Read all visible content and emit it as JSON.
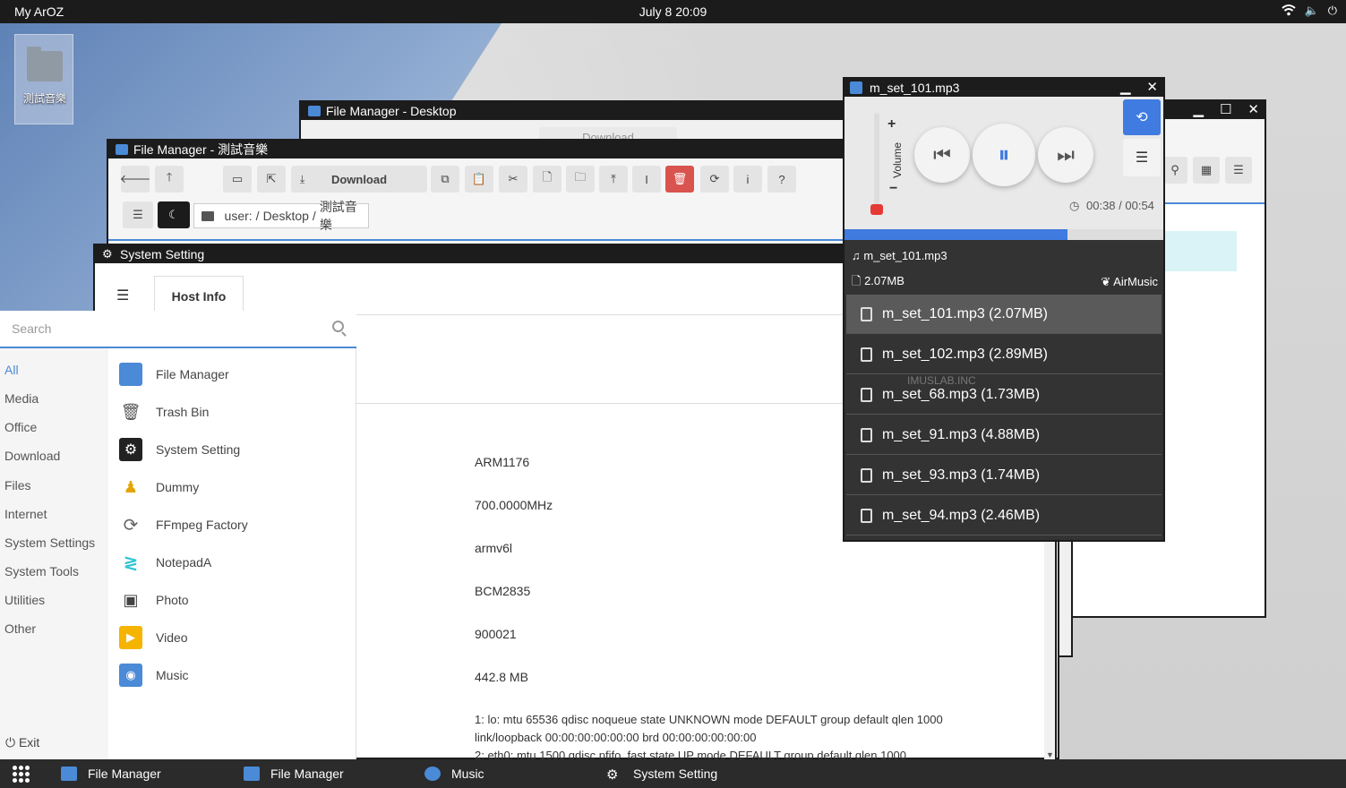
{
  "topbar": {
    "brand": "My ArOZ",
    "clock": "July 8 20:09",
    "wifi": "wifi",
    "volume": "🔈",
    "power": "⏻"
  },
  "desktop": {
    "icon_label": "測試音樂"
  },
  "fm_back": {
    "title": "File Manager - Desktop",
    "download_label": "Download"
  },
  "fm_front": {
    "title": "File Manager - 測試音樂",
    "download_label": "Download",
    "path_root": "user:",
    "path_1": "Desktop",
    "path_2": "測試音樂",
    "sep": "/"
  },
  "system_setting": {
    "title": "System Setting",
    "tab": "Host Info",
    "values": [
      "ARM1176",
      "700.0000MHz",
      "armv6l",
      "BCM2835",
      "900021",
      "442.8 MB"
    ],
    "net_1": "1: lo: mtu 65536 qdisc noqueue state UNKNOWN mode DEFAULT group default qlen 1000",
    "net_2": "link/loopback 00:00:00:00:00:00 brd 00:00:00:00:00:00",
    "net_3": "2: eth0: mtu 1500 qdisc pfifo_fast state UP mode DEFAULT group default qlen 1000"
  },
  "startmenu": {
    "search_placeholder": "Search",
    "categories": [
      "All",
      "Media",
      "Office",
      "Download",
      "Files",
      "Internet",
      "System Settings",
      "System Tools",
      "Utilities",
      "Other"
    ],
    "apps": [
      "File Manager",
      "Trash Bin",
      "System Setting",
      "Dummy",
      "FFmpeg Factory",
      "NotepadA",
      "Photo",
      "Video",
      "Music"
    ],
    "exit": "Exit"
  },
  "player": {
    "title": "m_set_101.mp3",
    "volume_label": "Volume",
    "time": "00:38 / 00:54",
    "progress_fraction": 0.7,
    "now_playing": "m_set_101.mp3",
    "size": "2.07MB",
    "brand": "AirMusic",
    "tracks": [
      "m_set_101.mp3 (2.07MB)",
      "m_set_102.mp3 (2.89MB)",
      "m_set_68.mp3 (1.73MB)",
      "m_set_91.mp3 (4.88MB)",
      "m_set_93.mp3 (1.74MB)",
      "m_set_94.mp3 (2.46MB)"
    ],
    "watermark": "IMUSLAB.INC"
  },
  "taskbar": {
    "items": [
      "File Manager",
      "File Manager",
      "Music",
      "System Setting"
    ]
  },
  "colors": {
    "accent": "#4a8ad6",
    "danger": "#d9534f",
    "progress": "#3f7be0",
    "volume_knob": "#e53935"
  }
}
